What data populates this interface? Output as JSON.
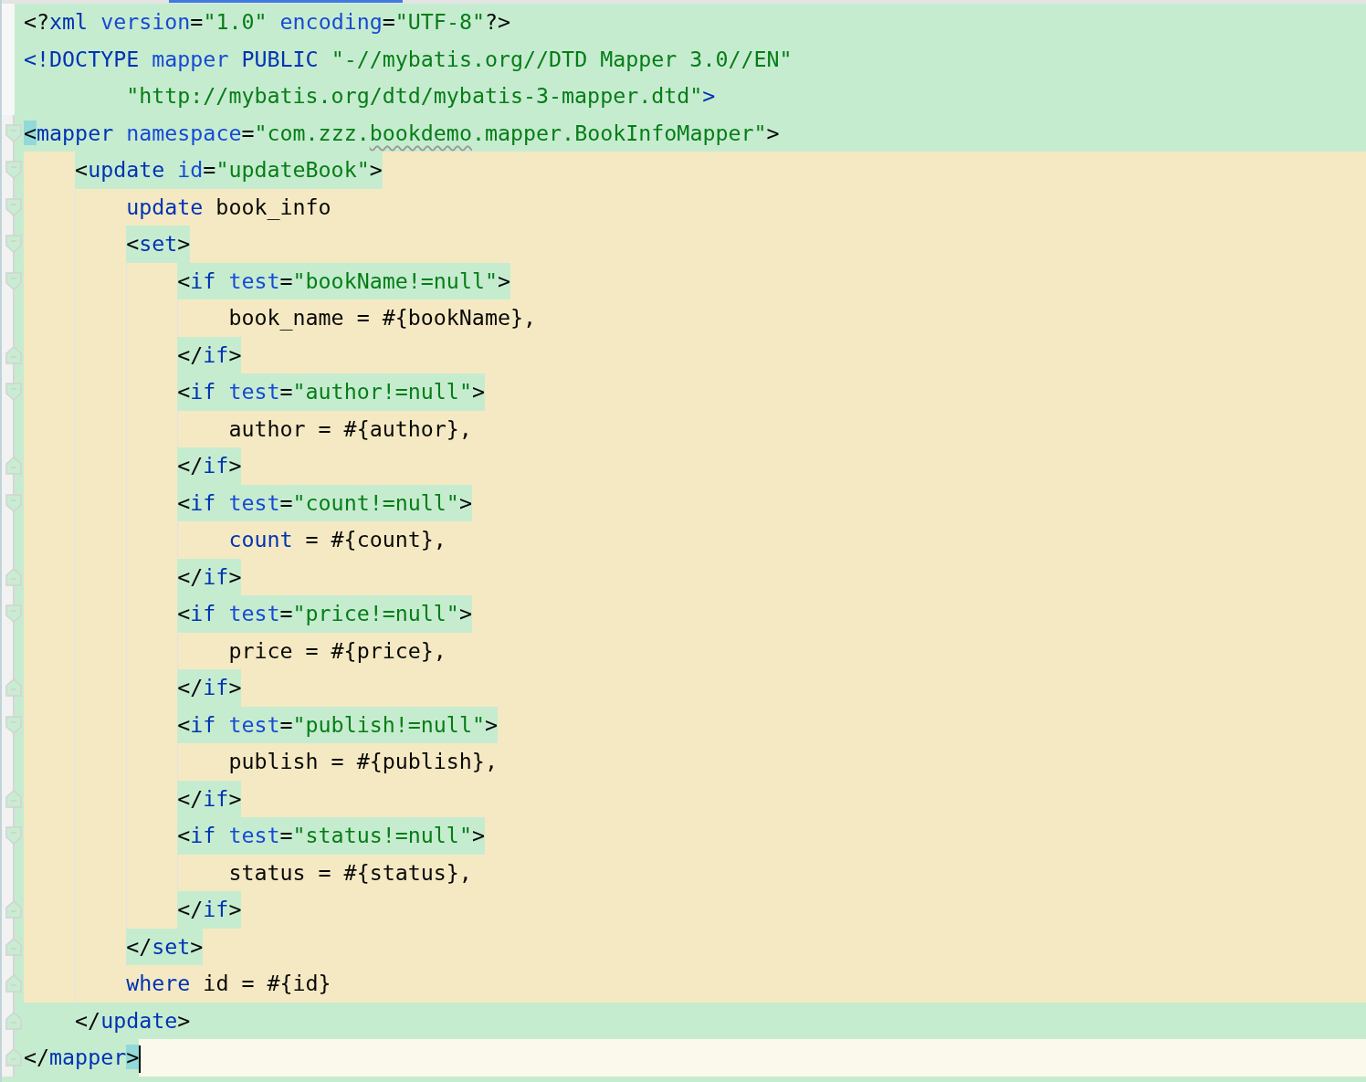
{
  "lines": [
    {
      "kind": "xml",
      "fold_start": false,
      "fold_end": false,
      "parts": [
        {
          "kind": "markup",
          "tokens": [
            {
              "kind": "punct",
              "text": "<?"
            },
            {
              "kind": "tag",
              "text": "xml"
            },
            {
              "kind": "attr",
              "text": " version"
            },
            {
              "kind": "punct",
              "text": "="
            },
            {
              "kind": "value",
              "text": "\"1.0\""
            },
            {
              "kind": "attr",
              "text": " encoding"
            },
            {
              "kind": "punct",
              "text": "="
            },
            {
              "kind": "value",
              "text": "\"UTF-8\""
            },
            {
              "kind": "punct",
              "text": "?>"
            }
          ]
        }
      ]
    },
    {
      "kind": "xml",
      "fold_start": false,
      "fold_end": false,
      "parts": [
        {
          "kind": "markup",
          "tokens": [
            {
              "kind": "tag",
              "text": "<!DOCTYPE"
            },
            {
              "kind": "attr",
              "text": " mapper"
            },
            {
              "kind": "tag",
              "text": " PUBLIC"
            },
            {
              "kind": "value",
              "text": " \"-//mybatis.org//DTD Mapper 3.0//EN\""
            }
          ]
        }
      ]
    },
    {
      "kind": "xml",
      "fold_start": false,
      "fold_end": false,
      "continuation": true,
      "parts": [
        {
          "kind": "markup",
          "tokens": [
            {
              "kind": "value",
              "text": "\"http://mybatis.org/dtd/mybatis-3-mapper.dtd\""
            },
            {
              "kind": "tag",
              "text": ">"
            }
          ]
        }
      ]
    },
    {
      "kind": "xml",
      "fold_start": true,
      "fold_end": false,
      "parts": [
        {
          "kind": "markup",
          "tokens": [
            {
              "kind": "punct",
              "text": "<",
              "match": true
            },
            {
              "kind": "tag",
              "text": "mapper"
            },
            {
              "kind": "attr",
              "text": " namespace"
            },
            {
              "kind": "punct",
              "text": "="
            },
            {
              "kind": "value",
              "text": "\"com.zzz."
            },
            {
              "kind": "value",
              "text": "bookdemo",
              "typo": true
            },
            {
              "kind": "value",
              "text": ".mapper.BookInfoMapper\""
            },
            {
              "kind": "punct",
              "text": ">"
            }
          ]
        }
      ],
      "children": [
        {
          "kind": "sql",
          "fold_start": true,
          "fold_end": false,
          "parts": [
            {
              "kind": "markup",
              "tokens": [
                {
                  "kind": "punct",
                  "text": "<"
                },
                {
                  "kind": "tag",
                  "text": "update"
                },
                {
                  "kind": "attr",
                  "text": " id"
                },
                {
                  "kind": "punct",
                  "text": "="
                },
                {
                  "kind": "value",
                  "text": "\"updateBook\""
                },
                {
                  "kind": "punct",
                  "text": ">"
                }
              ]
            }
          ],
          "children": [
            {
              "kind": "sql",
              "fold_start": true,
              "fold_end": false,
              "parts": [
                {
                  "kind": "sql",
                  "tokens": [
                    {
                      "kind": "keyword",
                      "text": "update"
                    },
                    {
                      "kind": "text",
                      "text": " book_info"
                    }
                  ]
                }
              ]
            },
            {
              "kind": "sql",
              "fold_start": true,
              "fold_end": false,
              "parts": [
                {
                  "kind": "markup",
                  "tokens": [
                    {
                      "kind": "punct",
                      "text": "<"
                    },
                    {
                      "kind": "tag",
                      "text": "set"
                    },
                    {
                      "kind": "punct",
                      "text": ">"
                    }
                  ]
                }
              ],
              "children": [
                {
                  "kind": "sql",
                  "fold_start": true,
                  "fold_end": false,
                  "parts": [
                    {
                      "kind": "markup",
                      "tokens": [
                        {
                          "kind": "punct",
                          "text": "<"
                        },
                        {
                          "kind": "tag",
                          "text": "if"
                        },
                        {
                          "kind": "attr",
                          "text": " test"
                        },
                        {
                          "kind": "punct",
                          "text": "="
                        },
                        {
                          "kind": "value",
                          "text": "\"bookName!=null\""
                        },
                        {
                          "kind": "punct",
                          "text": ">"
                        }
                      ]
                    }
                  ],
                  "children": [
                    {
                      "kind": "sql",
                      "fold_start": false,
                      "fold_end": false,
                      "parts": [
                        {
                          "kind": "sql",
                          "tokens": [
                            {
                              "kind": "text",
                              "text": "book_name = #{bookName},"
                            }
                          ]
                        }
                      ]
                    }
                  ]
                },
                {
                  "kind": "sql",
                  "fold_start": false,
                  "fold_end": true,
                  "parts": [
                    {
                      "kind": "markup",
                      "tokens": [
                        {
                          "kind": "punct",
                          "text": "</"
                        },
                        {
                          "kind": "tag",
                          "text": "if"
                        },
                        {
                          "kind": "punct",
                          "text": ">"
                        }
                      ]
                    }
                  ]
                },
                {
                  "kind": "sql",
                  "fold_start": true,
                  "fold_end": false,
                  "parts": [
                    {
                      "kind": "markup",
                      "tokens": [
                        {
                          "kind": "punct",
                          "text": "<"
                        },
                        {
                          "kind": "tag",
                          "text": "if"
                        },
                        {
                          "kind": "attr",
                          "text": " test"
                        },
                        {
                          "kind": "punct",
                          "text": "="
                        },
                        {
                          "kind": "value",
                          "text": "\"author!=null\""
                        },
                        {
                          "kind": "punct",
                          "text": ">"
                        }
                      ]
                    }
                  ],
                  "children": [
                    {
                      "kind": "sql",
                      "fold_start": false,
                      "fold_end": false,
                      "parts": [
                        {
                          "kind": "sql",
                          "tokens": [
                            {
                              "kind": "text",
                              "text": "author = #{author},"
                            }
                          ]
                        }
                      ]
                    }
                  ]
                },
                {
                  "kind": "sql",
                  "fold_start": false,
                  "fold_end": true,
                  "parts": [
                    {
                      "kind": "markup",
                      "tokens": [
                        {
                          "kind": "punct",
                          "text": "</"
                        },
                        {
                          "kind": "tag",
                          "text": "if"
                        },
                        {
                          "kind": "punct",
                          "text": ">"
                        }
                      ]
                    }
                  ]
                },
                {
                  "kind": "sql",
                  "fold_start": true,
                  "fold_end": false,
                  "parts": [
                    {
                      "kind": "markup",
                      "tokens": [
                        {
                          "kind": "punct",
                          "text": "<"
                        },
                        {
                          "kind": "tag",
                          "text": "if"
                        },
                        {
                          "kind": "attr",
                          "text": " test"
                        },
                        {
                          "kind": "punct",
                          "text": "="
                        },
                        {
                          "kind": "value",
                          "text": "\"count!=null\""
                        },
                        {
                          "kind": "punct",
                          "text": ">"
                        }
                      ]
                    }
                  ],
                  "children": [
                    {
                      "kind": "sql",
                      "fold_start": false,
                      "fold_end": false,
                      "parts": [
                        {
                          "kind": "sql",
                          "tokens": [
                            {
                              "kind": "keyword",
                              "text": "count"
                            },
                            {
                              "kind": "text",
                              "text": " = #{count},"
                            }
                          ]
                        }
                      ]
                    }
                  ]
                },
                {
                  "kind": "sql",
                  "fold_start": false,
                  "fold_end": true,
                  "parts": [
                    {
                      "kind": "markup",
                      "tokens": [
                        {
                          "kind": "punct",
                          "text": "</"
                        },
                        {
                          "kind": "tag",
                          "text": "if"
                        },
                        {
                          "kind": "punct",
                          "text": ">"
                        }
                      ]
                    }
                  ]
                },
                {
                  "kind": "sql",
                  "fold_start": true,
                  "fold_end": false,
                  "parts": [
                    {
                      "kind": "markup",
                      "tokens": [
                        {
                          "kind": "punct",
                          "text": "<"
                        },
                        {
                          "kind": "tag",
                          "text": "if"
                        },
                        {
                          "kind": "attr",
                          "text": " test"
                        },
                        {
                          "kind": "punct",
                          "text": "="
                        },
                        {
                          "kind": "value",
                          "text": "\"price!=null\""
                        },
                        {
                          "kind": "punct",
                          "text": ">"
                        }
                      ]
                    }
                  ],
                  "children": [
                    {
                      "kind": "sql",
                      "fold_start": false,
                      "fold_end": false,
                      "parts": [
                        {
                          "kind": "sql",
                          "tokens": [
                            {
                              "kind": "text",
                              "text": "price = #{price},"
                            }
                          ]
                        }
                      ]
                    }
                  ]
                },
                {
                  "kind": "sql",
                  "fold_start": false,
                  "fold_end": true,
                  "parts": [
                    {
                      "kind": "markup",
                      "tokens": [
                        {
                          "kind": "punct",
                          "text": "</"
                        },
                        {
                          "kind": "tag",
                          "text": "if"
                        },
                        {
                          "kind": "punct",
                          "text": ">"
                        }
                      ]
                    }
                  ]
                },
                {
                  "kind": "sql",
                  "fold_start": true,
                  "fold_end": false,
                  "parts": [
                    {
                      "kind": "markup",
                      "tokens": [
                        {
                          "kind": "punct",
                          "text": "<"
                        },
                        {
                          "kind": "tag",
                          "text": "if"
                        },
                        {
                          "kind": "attr",
                          "text": " test"
                        },
                        {
                          "kind": "punct",
                          "text": "="
                        },
                        {
                          "kind": "value",
                          "text": "\"publish!=null\""
                        },
                        {
                          "kind": "punct",
                          "text": ">"
                        }
                      ]
                    }
                  ],
                  "children": [
                    {
                      "kind": "sql",
                      "fold_start": false,
                      "fold_end": false,
                      "parts": [
                        {
                          "kind": "sql",
                          "tokens": [
                            {
                              "kind": "text",
                              "text": "publish = #{publish},"
                            }
                          ]
                        }
                      ]
                    }
                  ]
                },
                {
                  "kind": "sql",
                  "fold_start": false,
                  "fold_end": true,
                  "parts": [
                    {
                      "kind": "markup",
                      "tokens": [
                        {
                          "kind": "punct",
                          "text": "</"
                        },
                        {
                          "kind": "tag",
                          "text": "if"
                        },
                        {
                          "kind": "punct",
                          "text": ">"
                        }
                      ]
                    }
                  ]
                },
                {
                  "kind": "sql",
                  "fold_start": true,
                  "fold_end": false,
                  "parts": [
                    {
                      "kind": "markup",
                      "tokens": [
                        {
                          "kind": "punct",
                          "text": "<"
                        },
                        {
                          "kind": "tag",
                          "text": "if"
                        },
                        {
                          "kind": "attr",
                          "text": " test"
                        },
                        {
                          "kind": "punct",
                          "text": "="
                        },
                        {
                          "kind": "value",
                          "text": "\"status!=null\""
                        },
                        {
                          "kind": "punct",
                          "text": ">"
                        }
                      ]
                    }
                  ],
                  "children": [
                    {
                      "kind": "sql",
                      "fold_start": false,
                      "fold_end": false,
                      "parts": [
                        {
                          "kind": "sql",
                          "tokens": [
                            {
                              "kind": "text",
                              "text": "status = #{status},"
                            }
                          ]
                        }
                      ]
                    }
                  ]
                },
                {
                  "kind": "sql",
                  "fold_start": false,
                  "fold_end": true,
                  "parts": [
                    {
                      "kind": "markup",
                      "tokens": [
                        {
                          "kind": "punct",
                          "text": "</"
                        },
                        {
                          "kind": "tag",
                          "text": "if"
                        },
                        {
                          "kind": "punct",
                          "text": ">"
                        }
                      ]
                    }
                  ]
                }
              ]
            },
            {
              "kind": "sql",
              "fold_start": false,
              "fold_end": true,
              "parts": [
                {
                  "kind": "markup",
                  "tokens": [
                    {
                      "kind": "punct",
                      "text": "</"
                    },
                    {
                      "kind": "tag",
                      "text": "set"
                    },
                    {
                      "kind": "punct",
                      "text": ">"
                    }
                  ]
                }
              ]
            },
            {
              "kind": "sql",
              "fold_start": false,
              "fold_end": true,
              "parts": [
                {
                  "kind": "sql",
                  "tokens": [
                    {
                      "kind": "keyword",
                      "text": "where"
                    },
                    {
                      "kind": "text",
                      "text": " id = #{id}"
                    }
                  ]
                }
              ]
            }
          ]
        },
        {
          "kind": "xml",
          "fold_start": false,
          "fold_end": true,
          "parts": [
            {
              "kind": "markup",
              "tokens": [
                {
                  "kind": "punct",
                  "text": "</"
                },
                {
                  "kind": "tag",
                  "text": "update"
                },
                {
                  "kind": "punct",
                  "text": ">"
                }
              ]
            }
          ]
        }
      ]
    },
    {
      "kind": "caret",
      "fold_start": false,
      "fold_end": true,
      "parts": [
        {
          "kind": "markup",
          "tokens": [
            {
              "kind": "punct",
              "text": "</"
            },
            {
              "kind": "tag",
              "text": "mapper"
            },
            {
              "kind": "punct",
              "text": ">",
              "match": true
            }
          ]
        }
      ]
    }
  ]
}
